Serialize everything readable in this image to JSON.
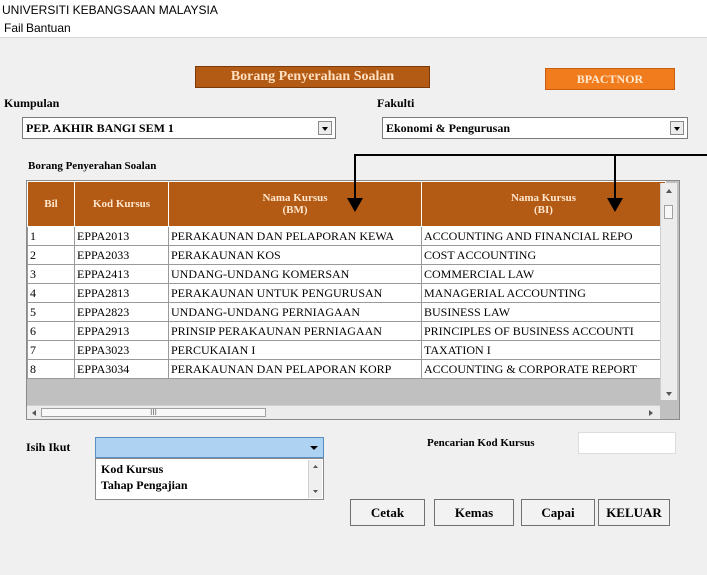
{
  "window": {
    "title": "UNIVERSITI KEBANGSAAN MALAYSIA"
  },
  "menu": {
    "items": [
      "Fail",
      "Bantuan"
    ]
  },
  "form": {
    "banner": "Borang Penyerahan Soalan",
    "badge": "BPACTNOR",
    "kumpulan_label": "Kumpulan",
    "kumpulan_value": "PEP. AKHIR BANGI SEM 1",
    "fakulti_label": "Fakulti",
    "fakulti_value": "Ekonomi & Pengurusan",
    "section_title": "Borang Penyerahan Soalan"
  },
  "table": {
    "headers": [
      "Bil",
      "Kod Kursus",
      "Nama Kursus (BM)",
      "Nama Kursus (BI)"
    ],
    "header_lines": {
      "bm": [
        "Nama Kursus",
        "(BM)"
      ],
      "bi": [
        "Nama Kursus",
        "(BI)"
      ]
    },
    "rows": [
      [
        "1",
        "EPPA2013",
        "PERAKAUNAN DAN PELAPORAN KEWA",
        "ACCOUNTING AND FINANCIAL REPO"
      ],
      [
        "2",
        "EPPA2033",
        "PERAKAUNAN KOS",
        "COST ACCOUNTING"
      ],
      [
        "3",
        "EPPA2413",
        "UNDANG-UNDANG KOMERSAN",
        "COMMERCIAL LAW"
      ],
      [
        "4",
        "EPPA2813",
        "PERAKAUNAN UNTUK PENGURUSAN",
        "MANAGERIAL ACCOUNTING"
      ],
      [
        "5",
        "EPPA2823",
        "UNDANG-UNDANG PERNIAGAAN",
        "BUSINESS LAW"
      ],
      [
        "6",
        "EPPA2913",
        "PRINSIP PERAKAUNAN PERNIAGAAN",
        "PRINCIPLES OF BUSINESS ACCOUNTI"
      ],
      [
        "7",
        "EPPA3023",
        "PERCUKAIAN I",
        "TAXATION I"
      ],
      [
        "8",
        "EPPA3034",
        "PERAKAUNAN DAN PELAPORAN KORP",
        "ACCOUNTING & CORPORATE REPORT"
      ]
    ],
    "hscroll_thumb_glyph": "III"
  },
  "sort": {
    "label": "Isih Ikut",
    "value": "",
    "options": [
      "Kod Kursus",
      "Tahap Pengajian"
    ]
  },
  "search": {
    "label": "Pencarian Kod Kursus",
    "value": ""
  },
  "buttons": {
    "cetak": "Cetak",
    "kemas": "Kemas",
    "capai": "Capai",
    "keluar": "KELUAR"
  },
  "colors": {
    "header_bg": "#b35a14",
    "badge_bg": "#f07c1e",
    "window_bg": "#f0f0f0"
  }
}
